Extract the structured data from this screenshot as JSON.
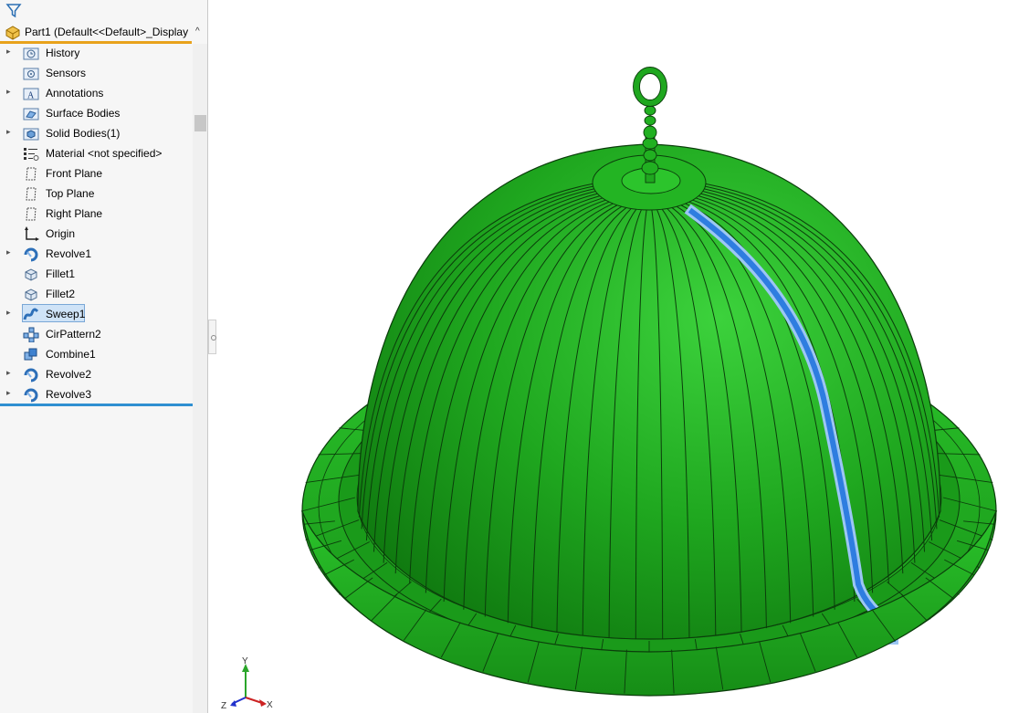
{
  "feature_tree": {
    "root_label": "Part1  (Default<<Default>_Display",
    "collapse_glyph": "^",
    "items": [
      {
        "label": "History",
        "icon": "history-folder-icon",
        "expandable": true,
        "selected": false
      },
      {
        "label": "Sensors",
        "icon": "sensors-folder-icon",
        "expandable": false,
        "selected": false
      },
      {
        "label": "Annotations",
        "icon": "annotations-folder-icon",
        "expandable": true,
        "selected": false
      },
      {
        "label": "Surface Bodies",
        "icon": "surface-bodies-folder-icon",
        "expandable": false,
        "selected": false
      },
      {
        "label": "Solid Bodies(1)",
        "icon": "solid-bodies-folder-icon",
        "expandable": true,
        "selected": false
      },
      {
        "label": "Material <not specified>",
        "icon": "material-icon",
        "expandable": false,
        "selected": false
      },
      {
        "label": "Front Plane",
        "icon": "plane-icon",
        "expandable": false,
        "selected": false
      },
      {
        "label": "Top Plane",
        "icon": "plane-icon",
        "expandable": false,
        "selected": false
      },
      {
        "label": "Right Plane",
        "icon": "plane-icon",
        "expandable": false,
        "selected": false
      },
      {
        "label": "Origin",
        "icon": "origin-icon",
        "expandable": false,
        "selected": false
      },
      {
        "label": "Revolve1",
        "icon": "revolve-icon",
        "expandable": true,
        "selected": false
      },
      {
        "label": "Fillet1",
        "icon": "fillet-icon",
        "expandable": false,
        "selected": false
      },
      {
        "label": "Fillet2",
        "icon": "fillet-icon",
        "expandable": false,
        "selected": false
      },
      {
        "label": "Sweep1",
        "icon": "sweep-icon",
        "expandable": true,
        "selected": true
      },
      {
        "label": "CirPattern2",
        "icon": "circular-pattern-icon",
        "expandable": false,
        "selected": false
      },
      {
        "label": "Combine1",
        "icon": "combine-icon",
        "expandable": false,
        "selected": false
      },
      {
        "label": "Revolve2",
        "icon": "revolve-icon",
        "expandable": true,
        "selected": false
      },
      {
        "label": "Revolve3",
        "icon": "revolve-icon",
        "expandable": true,
        "selected": false
      }
    ]
  },
  "viewport": {
    "model_color": "#1fa71f",
    "model_edge_color": "#0b3d0b",
    "selection_color": "#2e7de0",
    "triad": {
      "y_label": "Y",
      "x_label": "X",
      "z_label": "Z"
    }
  },
  "colors": {
    "root_underline": "#e8a21b",
    "rollback_bar": "#2f8fd1",
    "selected_bg": "#cfe3f7"
  }
}
